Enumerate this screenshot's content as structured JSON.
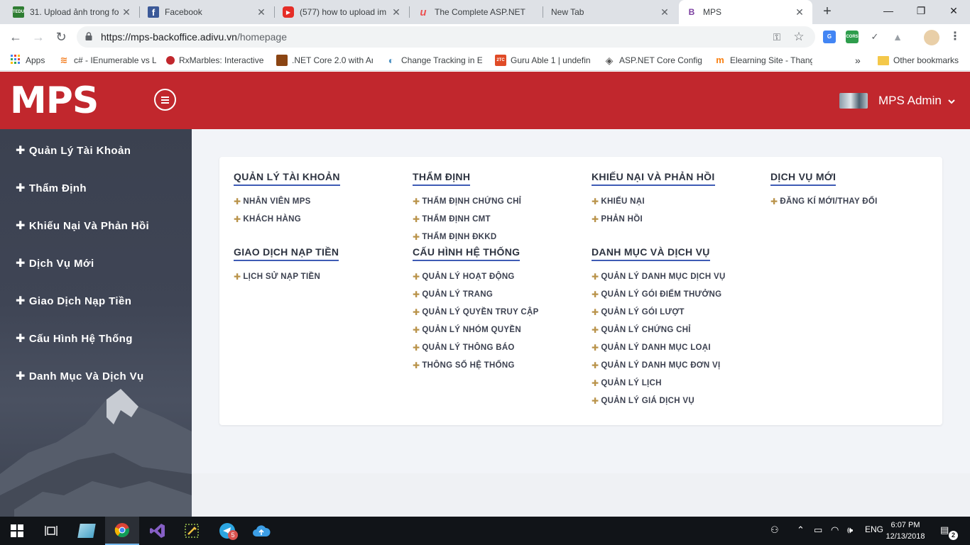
{
  "browser": {
    "tabs": [
      {
        "title": "31. Upload ảnh trong fo",
        "favicon": "tedu-favicon",
        "color": "#2e7d32",
        "abbr": "TEDU"
      },
      {
        "title": "Facebook",
        "favicon": "facebook-favicon",
        "color": "#3b5998",
        "abbr": "f"
      },
      {
        "title": "(577) how to upload im",
        "favicon": "youtube-favicon",
        "color": "#e52d27",
        "abbr": "▶"
      },
      {
        "title": "The Complete ASP.NET",
        "favicon": "udemy-favicon",
        "color": "#ec5252",
        "abbr": "u"
      },
      {
        "title": "New Tab",
        "favicon": "",
        "color": "",
        "abbr": ""
      },
      {
        "title": "MPS",
        "favicon": "mps-favicon",
        "color": "#7b3fa0",
        "abbr": "B"
      }
    ],
    "address": {
      "domain": "https://mps-backoffice.adivu.vn",
      "path": "/homepage"
    },
    "bookmarks": [
      {
        "label": "Apps",
        "icon": "apps-grid-icon",
        "color": "#4285f4"
      },
      {
        "label": "c# - IEnumerable vs L",
        "icon": "stackoverflow-icon",
        "color": "#f48024"
      },
      {
        "label": "RxMarbles: Interactive",
        "icon": "rxmarbles-icon",
        "color": "#c1272d"
      },
      {
        "label": ".NET Core 2.0 with An",
        "icon": "site-icon",
        "color": "#8b4513"
      },
      {
        "label": "Change Tracking in En",
        "icon": "globe-icon",
        "color": "#4a90c2"
      },
      {
        "label": "Guru Able 1 | undefin",
        "icon": "ztc-icon",
        "color": "#e04b27"
      },
      {
        "label": "ASP.NET Core Configu",
        "icon": "diamond-icon",
        "color": "#555555"
      },
      {
        "label": "Elearning Site - Thang",
        "icon": "moodle-icon",
        "color": "#f98012"
      }
    ],
    "more_bookmarks": "»",
    "other_bookmarks": "Other bookmarks"
  },
  "app": {
    "logo": "MPS",
    "user_name": "MPS Admin"
  },
  "sidebar": {
    "items": [
      "Quản Lý Tài Khoản",
      "Thẩm Định",
      "Khiếu Nại Và Phản Hồi",
      "Dịch Vụ Mới",
      "Giao Dịch Nạp Tiền",
      "Cấu Hình Hệ Thống",
      "Danh Mục Và Dịch Vụ"
    ]
  },
  "menu": {
    "groups": [
      {
        "title": "QUẢN LÝ TÀI KHOẢN",
        "links": [
          "NHÂN VIÊN MPS",
          "KHÁCH HÀNG"
        ]
      },
      {
        "title": "THẨM ĐỊNH",
        "links": [
          "THẨM ĐỊNH CHỨNG CHỈ",
          "THẨM ĐỊNH CMT",
          "THẨM ĐỊNH ĐKKD"
        ]
      },
      {
        "title": "KHIẾU NẠI VÀ PHẢN HỒI",
        "links": [
          "KHIẾU NẠI",
          "PHẢN HỒI"
        ]
      },
      {
        "title": "DỊCH VỤ MỚI",
        "links": [
          "ĐĂNG KÍ MỚI/THAY ĐỔI"
        ]
      },
      {
        "title": "GIAO DỊCH NẠP TIỀN",
        "links": [
          "LỊCH SỬ NẠP TIỀN"
        ]
      },
      {
        "title": "CẤU HÌNH HỆ THỐNG",
        "links": [
          "QUẢN LÝ HOẠT ĐỘNG",
          "QUẢN LÝ TRANG",
          "QUẢN LÝ QUYỀN TRUY CẬP",
          "QUẢN LÝ NHÓM QUYỀN",
          "QUẢN LÝ THÔNG BÁO",
          "THÔNG SỐ HỆ THỐNG"
        ]
      },
      {
        "title": "DANH MỤC VÀ DỊCH VỤ",
        "links": [
          "QUẢN LÝ DANH MỤC DỊCH VỤ",
          "QUẢN LÝ GÓI ĐIỂM THƯỞNG",
          "QUẢN LÝ GÓI LƯỢT",
          "QUẢN LÝ CHỨNG CHỈ",
          "QUẢN LÝ DANH MỤC LOẠI",
          "QUẢN LÝ DANH MỤC ĐƠN VỊ",
          "QUẢN LÝ LỊCH",
          "QUẢN LÝ GIÁ DỊCH VỤ"
        ]
      }
    ]
  },
  "taskbar": {
    "language": "ENG",
    "time": "6:07 PM",
    "date": "12/13/2018",
    "telegram_badge": "5",
    "notification_count": "2"
  },
  "colors": {
    "header": "#c1272d",
    "sidebar": "#3f4555",
    "accent_underline": "#3e5bb5",
    "link_plus": "#b9934a"
  }
}
